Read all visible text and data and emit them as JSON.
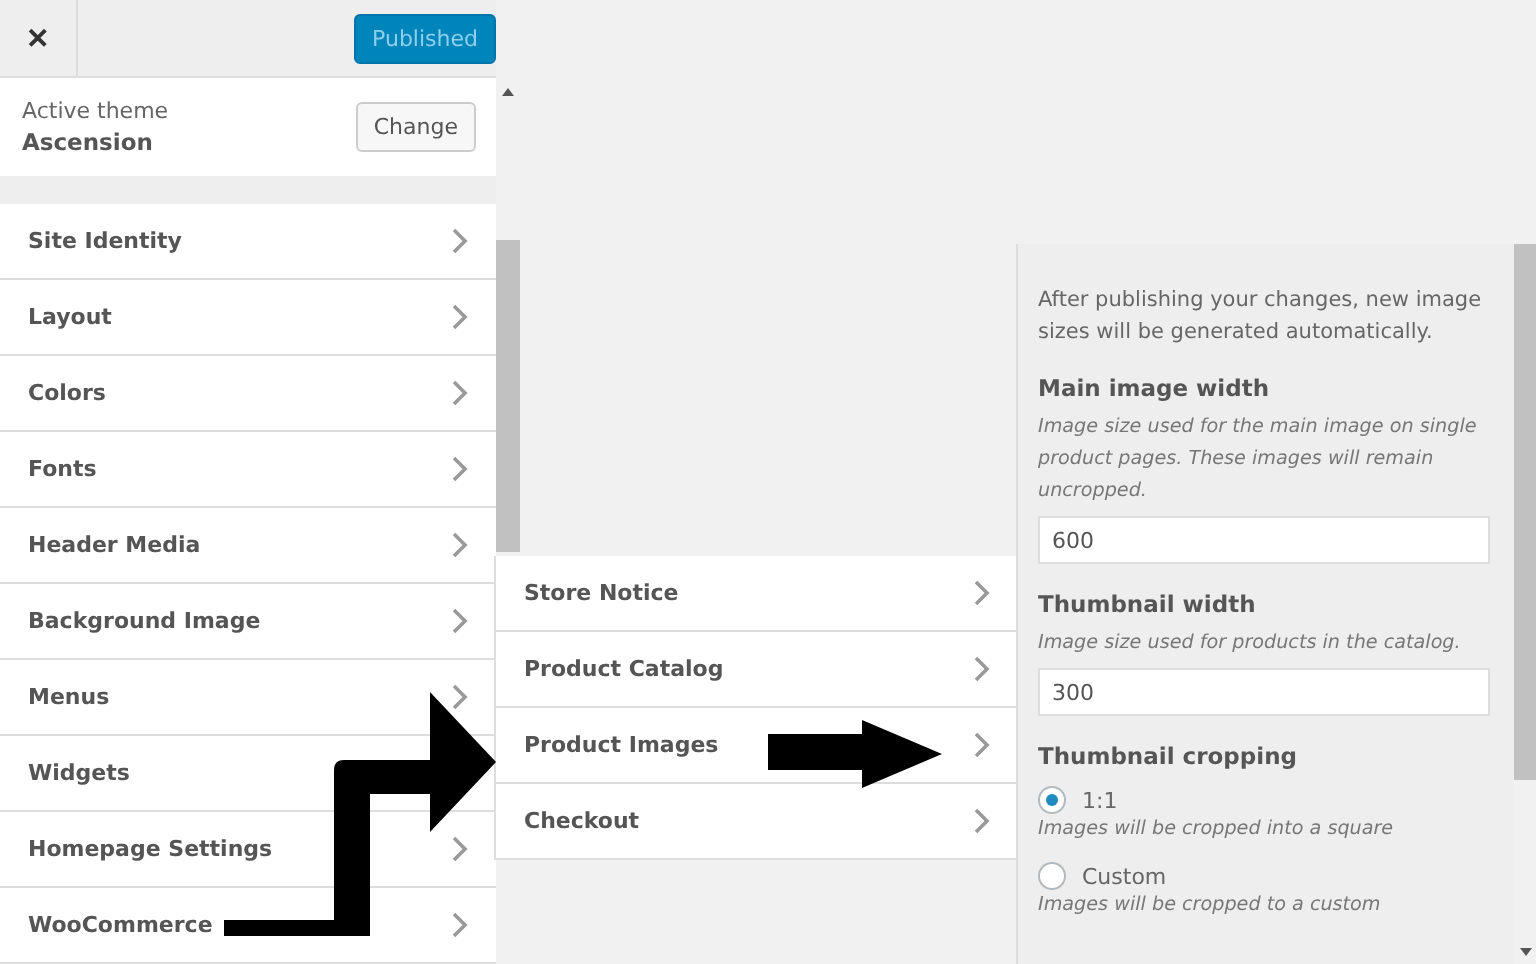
{
  "header": {
    "close": "✕",
    "publish_button": "Published"
  },
  "active_theme": {
    "label": "Active theme",
    "name": "Ascension",
    "button": "Change"
  },
  "panels": [
    {
      "items": [
        {
          "label": "Site Identity"
        },
        {
          "label": "Layout"
        },
        {
          "label": "Colors"
        },
        {
          "label": "Fonts"
        },
        {
          "label": "Header Media"
        },
        {
          "label": "Background Image"
        },
        {
          "label": "Menus"
        },
        {
          "label": "Widgets"
        },
        {
          "label": "Homepage Settings"
        },
        {
          "label": "WooCommerce"
        }
      ]
    },
    {
      "items": [
        {
          "label": "Store Notice"
        },
        {
          "label": "Product Catalog"
        },
        {
          "label": "Product Images"
        },
        {
          "label": "Checkout"
        }
      ]
    }
  ],
  "product_images": {
    "intro": "After publishing your changes, new image sizes will be generated automatically.",
    "settings": [
      {
        "kind": "number",
        "title": "Main image width",
        "description": "Image size used for the main image on single product pages. These images will remain uncropped.",
        "value": "600"
      },
      {
        "kind": "number",
        "title": "Thumbnail width",
        "description": "Image size used for products in the catalog.",
        "value": "300"
      },
      {
        "kind": "radio",
        "title": "Thumbnail cropping",
        "options": [
          {
            "label": "1:1",
            "description": "Images will be cropped into a square",
            "selected": true
          },
          {
            "label": "Custom",
            "description": "Images will be cropped to a custom",
            "selected": false
          }
        ]
      }
    ]
  }
}
